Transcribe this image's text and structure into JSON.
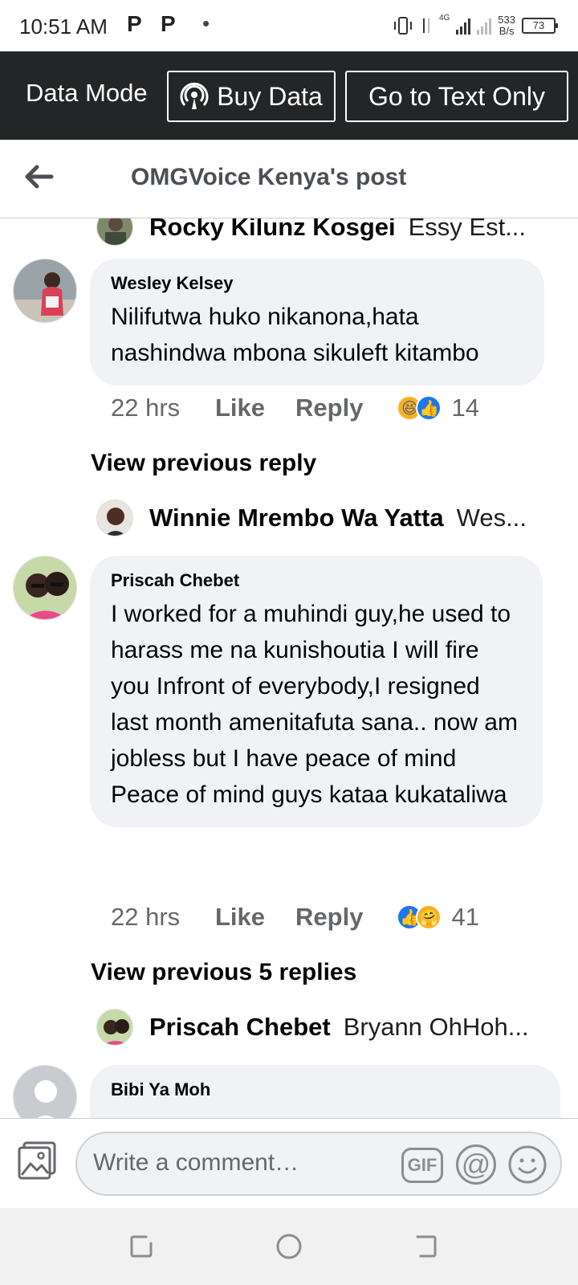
{
  "status_bar": {
    "time": "10:51 AM",
    "notif_icons": [
      "P",
      "P"
    ],
    "network": "4G",
    "speed_value": "533",
    "speed_unit": "B/s",
    "battery": "73"
  },
  "data_banner": {
    "mode_label": "Data Mode",
    "buy_label": "Buy Data",
    "text_only_label": "Go to Text Only"
  },
  "header": {
    "title": "OMGVoice Kenya's post"
  },
  "feed": {
    "reply_previews": [
      {
        "name": "Rocky Kilunz Kosgei",
        "text": "Essy Est..."
      },
      {
        "name": "Winnie Mrembo Wa Yatta",
        "text": "Wes..."
      },
      {
        "name": "Priscah Chebet",
        "text": "Bryann OhHoh..."
      }
    ],
    "comments": [
      {
        "author": "Wesley Kelsey",
        "text": "Nilifutwa huko nikanona,hata nashindwa mbona sikuleft kitambo",
        "time": "22 hrs",
        "like_label": "Like",
        "reply_label": "Reply",
        "reaction_count": "14",
        "view_previous": "View previous reply"
      },
      {
        "author": "Priscah Chebet",
        "text": "I worked for a muhindi guy,he used to harass me na kunishoutia I will fire you Infront of everybody,I resigned last month amenitafuta sana.. now am jobless but I have peace of mind\nPeace of mind guys kataa kukataliwa",
        "time": "22 hrs",
        "like_label": "Like",
        "reply_label": "Reply",
        "reaction_count": "41",
        "view_previous": "View previous 5 replies"
      },
      {
        "author": "Bibi Ya Moh"
      }
    ]
  },
  "composer": {
    "placeholder": "Write a comment…",
    "gif_label": "GIF",
    "at_label": "@"
  },
  "colors": {
    "banner_bg": "#242526",
    "bubble_bg": "#f0f2f5",
    "meta_text": "#65676b",
    "like_blue": "#1877f2",
    "reaction_yellow": "#f7b125"
  }
}
